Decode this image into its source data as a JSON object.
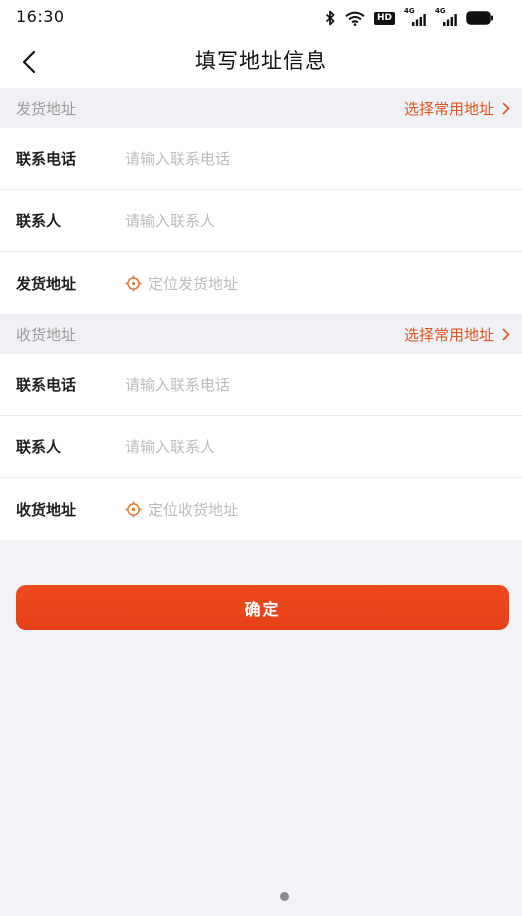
{
  "status_bar": {
    "time": "16:30",
    "hd_badge": "HD",
    "network_1": "4G",
    "network_2": "4G",
    "icons": [
      "bluetooth-icon",
      "wifi-icon",
      "hd-badge",
      "signal-icon",
      "signal-icon",
      "battery-icon"
    ]
  },
  "header": {
    "back_icon": "chevron-left-icon",
    "title": "填写地址信息"
  },
  "sections": [
    {
      "title": "发货地址",
      "link": "选择常用地址",
      "fields": [
        {
          "label": "联系电话",
          "placeholder": "请输入联系电话"
        },
        {
          "label": "联系人",
          "placeholder": "请输入联系人"
        },
        {
          "label": "发货地址",
          "location_text": "定位发货地址",
          "icon": "locate-icon"
        }
      ]
    },
    {
      "title": "收货地址",
      "link": "选择常用地址",
      "fields": [
        {
          "label": "联系电话",
          "placeholder": "请输入联系电话"
        },
        {
          "label": "联系人",
          "placeholder": "请输入联系人"
        },
        {
          "label": "收货地址",
          "location_text": "定位收货地址",
          "icon": "locate-icon"
        }
      ]
    }
  ],
  "confirm_button": {
    "label": "确定"
  },
  "colors": {
    "accent": "#ea451b",
    "link": "#df541f",
    "placeholder": "#bcbcbc",
    "section_bg": "#eff1f4",
    "page_bg": "#f1f3f6",
    "locate_icon": "#e07a34"
  }
}
